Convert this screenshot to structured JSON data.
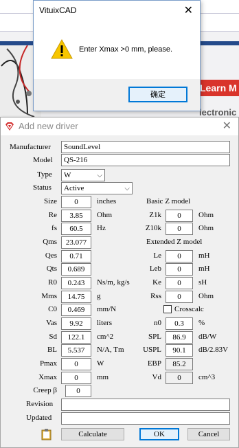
{
  "background": {
    "learn_more": "Learn M",
    "electronic": "lectronic"
  },
  "message_box": {
    "title": "VituixCAD",
    "close": "✕",
    "message": "Enter Xmax >0 mm, please.",
    "ok_label": "确定"
  },
  "driver_dialog": {
    "title": "Add new driver",
    "close": "✕",
    "manufacturer_label": "Manufacturer",
    "manufacturer_value": "SoundLevel",
    "model_label": "Model",
    "model_value": "QS-216",
    "type_label": "Type",
    "type_value": "W",
    "status_label": "Status",
    "status_value": "Active",
    "left_params": [
      {
        "label": "Size",
        "value": "0",
        "unit": "inches"
      },
      {
        "label": "Re",
        "value": "3.85",
        "unit": "Ohm"
      },
      {
        "label": "fs",
        "value": "60.5",
        "unit": "Hz"
      },
      {
        "label": "Qms",
        "value": "23.077",
        "unit": ""
      },
      {
        "label": "Qes",
        "value": "0.71",
        "unit": ""
      },
      {
        "label": "Qts",
        "value": "0.689",
        "unit": ""
      },
      {
        "label": "R0",
        "value": "0.243",
        "unit": "Ns/m, kg/s"
      },
      {
        "label": "Mms",
        "value": "14.75",
        "unit": "g"
      },
      {
        "label": "C0",
        "value": "0.469",
        "unit": "mm/N"
      },
      {
        "label": "Vas",
        "value": "9.92",
        "unit": "liters"
      },
      {
        "label": "Sd",
        "value": "122.1",
        "unit": "cm^2"
      },
      {
        "label": "BL",
        "value": "5.537",
        "unit": "N/A, Tm"
      },
      {
        "label": "Pmax",
        "value": "0",
        "unit": "W"
      },
      {
        "label": "Xmax",
        "value": "0",
        "unit": "mm"
      },
      {
        "label": "Creep β",
        "value": "0",
        "unit": ""
      }
    ],
    "basic_z_heading": "Basic Z model",
    "basic_z": [
      {
        "label": "Z1k",
        "value": "0",
        "unit": "Ohm"
      },
      {
        "label": "Z10k",
        "value": "0",
        "unit": "Ohm"
      }
    ],
    "extended_z_heading": "Extended Z model",
    "extended_z": [
      {
        "label": "Le",
        "value": "0",
        "unit": "mH"
      },
      {
        "label": "Leb",
        "value": "0",
        "unit": "mH"
      },
      {
        "label": "Ke",
        "value": "0",
        "unit": "sH"
      },
      {
        "label": "Rss",
        "value": "0",
        "unit": "Ohm"
      }
    ],
    "crosscalc_label": "Crosscalc",
    "right_params": [
      {
        "label": "n0",
        "value": "0.3",
        "unit": "%"
      },
      {
        "label": "SPL",
        "value": "86.9",
        "unit": "dB/W"
      },
      {
        "label": "USPL",
        "value": "90.1",
        "unit": "dB/2.83V"
      },
      {
        "label": "EBP",
        "value": "85.2",
        "unit": ""
      },
      {
        "label": "Vd",
        "value": "0",
        "unit": "cm^3"
      }
    ],
    "revision_label": "Revision",
    "revision_value": "",
    "updated_label": "Updated",
    "updated_value": "",
    "calculate_label": "Calculate",
    "ok_label": "OK",
    "cancel_label": "Cancel"
  }
}
